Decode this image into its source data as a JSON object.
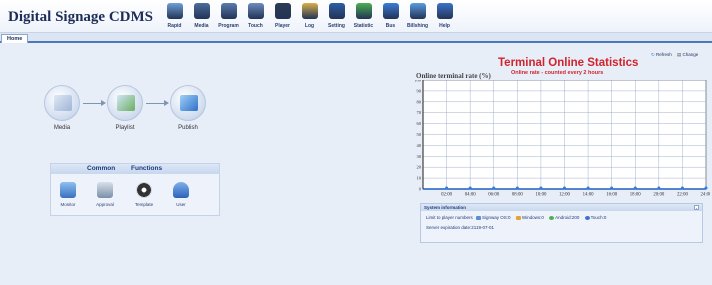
{
  "app": {
    "title": "Digital Signage CDMS"
  },
  "toolbar": [
    {
      "label": "Rapid",
      "icon": "rapid-icon",
      "color": "#6fa0d8"
    },
    {
      "label": "Media",
      "icon": "media-icon",
      "color": "#4b6d9e"
    },
    {
      "label": "Program",
      "icon": "program-icon",
      "color": "#5a7cae"
    },
    {
      "label": "Touch",
      "icon": "touch-icon",
      "color": "#6d8dbd"
    },
    {
      "label": "Player",
      "icon": "player-icon",
      "color": "#2d3c55"
    },
    {
      "label": "Log",
      "icon": "log-icon",
      "color": "#d8b04a"
    },
    {
      "label": "Setting",
      "icon": "setting-icon",
      "color": "#2d5fa6"
    },
    {
      "label": "Statistic",
      "icon": "statistic-icon",
      "color": "#4caf50"
    },
    {
      "label": "Bus",
      "icon": "bus-icon",
      "color": "#3b7dd8"
    },
    {
      "label": "Billshing",
      "icon": "billshing-icon",
      "color": "#5a9be0"
    },
    {
      "label": "Help",
      "icon": "help-icon",
      "color": "#3d73c8"
    }
  ],
  "tabs": [
    {
      "label": "Home"
    }
  ],
  "flow": [
    {
      "label": "Media",
      "icon": "media-folder-icon",
      "color": "#b7c8e4"
    },
    {
      "label": "Playlist",
      "icon": "playlist-icon",
      "color": "#7fb7e6"
    },
    {
      "label": "Publish",
      "icon": "publish-monitor-icon",
      "color": "#3a7fd6"
    }
  ],
  "common": {
    "title_left": "Common",
    "title_right": "Functions",
    "items": [
      {
        "label": "Monitor",
        "icon": "monitor-icon",
        "color": "#5a8fd0"
      },
      {
        "label": "Approval",
        "icon": "approval-icon",
        "color": "#7a8fa8"
      },
      {
        "label": "Template",
        "icon": "template-icon",
        "color": "#333333"
      },
      {
        "label": "User",
        "icon": "user-icon",
        "color": "#4a7ec8"
      }
    ]
  },
  "stats": {
    "refresh_label": "Refresh",
    "change_label": "Change",
    "title": "Terminal Online Statistics",
    "subtitle": "Online rate - counted every 2 hours"
  },
  "chart_data": {
    "type": "line",
    "title": "Terminal Online Statistics",
    "subtitle": "Online rate - counted every 2 hours",
    "ylabel": "Online terminal rate (%)",
    "xlabel": "",
    "x": [
      "02:00",
      "04:00",
      "06:00",
      "08:00",
      "10:00",
      "12:00",
      "14:00",
      "16:00",
      "18:00",
      "20:00",
      "22:00",
      "24:00"
    ],
    "series": [
      {
        "values": [
          0,
          0,
          0,
          0,
          0,
          0,
          0,
          0,
          0,
          0,
          0,
          0
        ]
      }
    ],
    "ylim": [
      0,
      100
    ],
    "yticks": [
      0,
      10,
      20,
      30,
      40,
      50,
      60,
      70,
      80,
      90,
      100
    ],
    "grid": true,
    "line_color": "#1f5fbf"
  },
  "sysinfo": {
    "title": "System information",
    "limit_label": "Limit to player numbers",
    "counts": [
      {
        "label": "Signway OS:0",
        "icon": "signway-os-icon",
        "color": "#5a8fd0"
      },
      {
        "label": "Windows:0",
        "icon": "windows-icon",
        "color": "#e0a43a"
      },
      {
        "label": "Android:200",
        "icon": "android-icon",
        "color": "#4caf50"
      },
      {
        "label": "Touch:0",
        "icon": "touch-device-icon",
        "color": "#3d73c8"
      }
    ],
    "expiration": "Server expiration date:2119-07-01"
  }
}
